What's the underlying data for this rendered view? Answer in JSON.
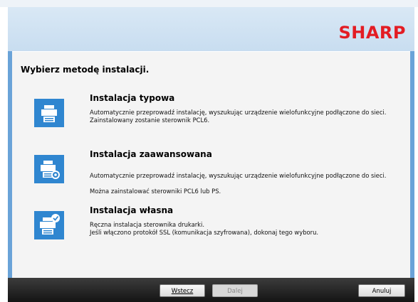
{
  "header": {
    "logo_text": "SHARP",
    "logo_color": "#e31c23",
    "accent_color": "#2f86d0"
  },
  "main": {
    "title": "Wybierz metodę instalacji.",
    "options": [
      {
        "name": "Instalacja typowa",
        "icon": "printer-icon",
        "lines": [
          "Automatycznie przeprowadź instalację, wyszukując urządzenie wielofunkcyjne podłączone do sieci.",
          "Zainstalowany zostanie sterownik PCL6."
        ]
      },
      {
        "name": "Instalacja zaawansowana",
        "icon": "printer-settings-icon",
        "lines": [
          "Automatycznie przeprowadź instalację, wyszukując urządzenie wielofunkcyjne podłączone do sieci.",
          "Można zainstalować sterowniki PCL6 lub PS."
        ]
      },
      {
        "name": "Instalacja własna",
        "icon": "printer-check-icon",
        "lines": [
          "Ręczna instalacja sterownika drukarki.",
          "Jeśli włączono protokół SSL (komunikacja szyfrowana), dokonaj tego wyboru."
        ]
      }
    ]
  },
  "footer": {
    "back_label": "Wstecz",
    "next_label": "Dalej",
    "cancel_label": "Anuluj"
  }
}
